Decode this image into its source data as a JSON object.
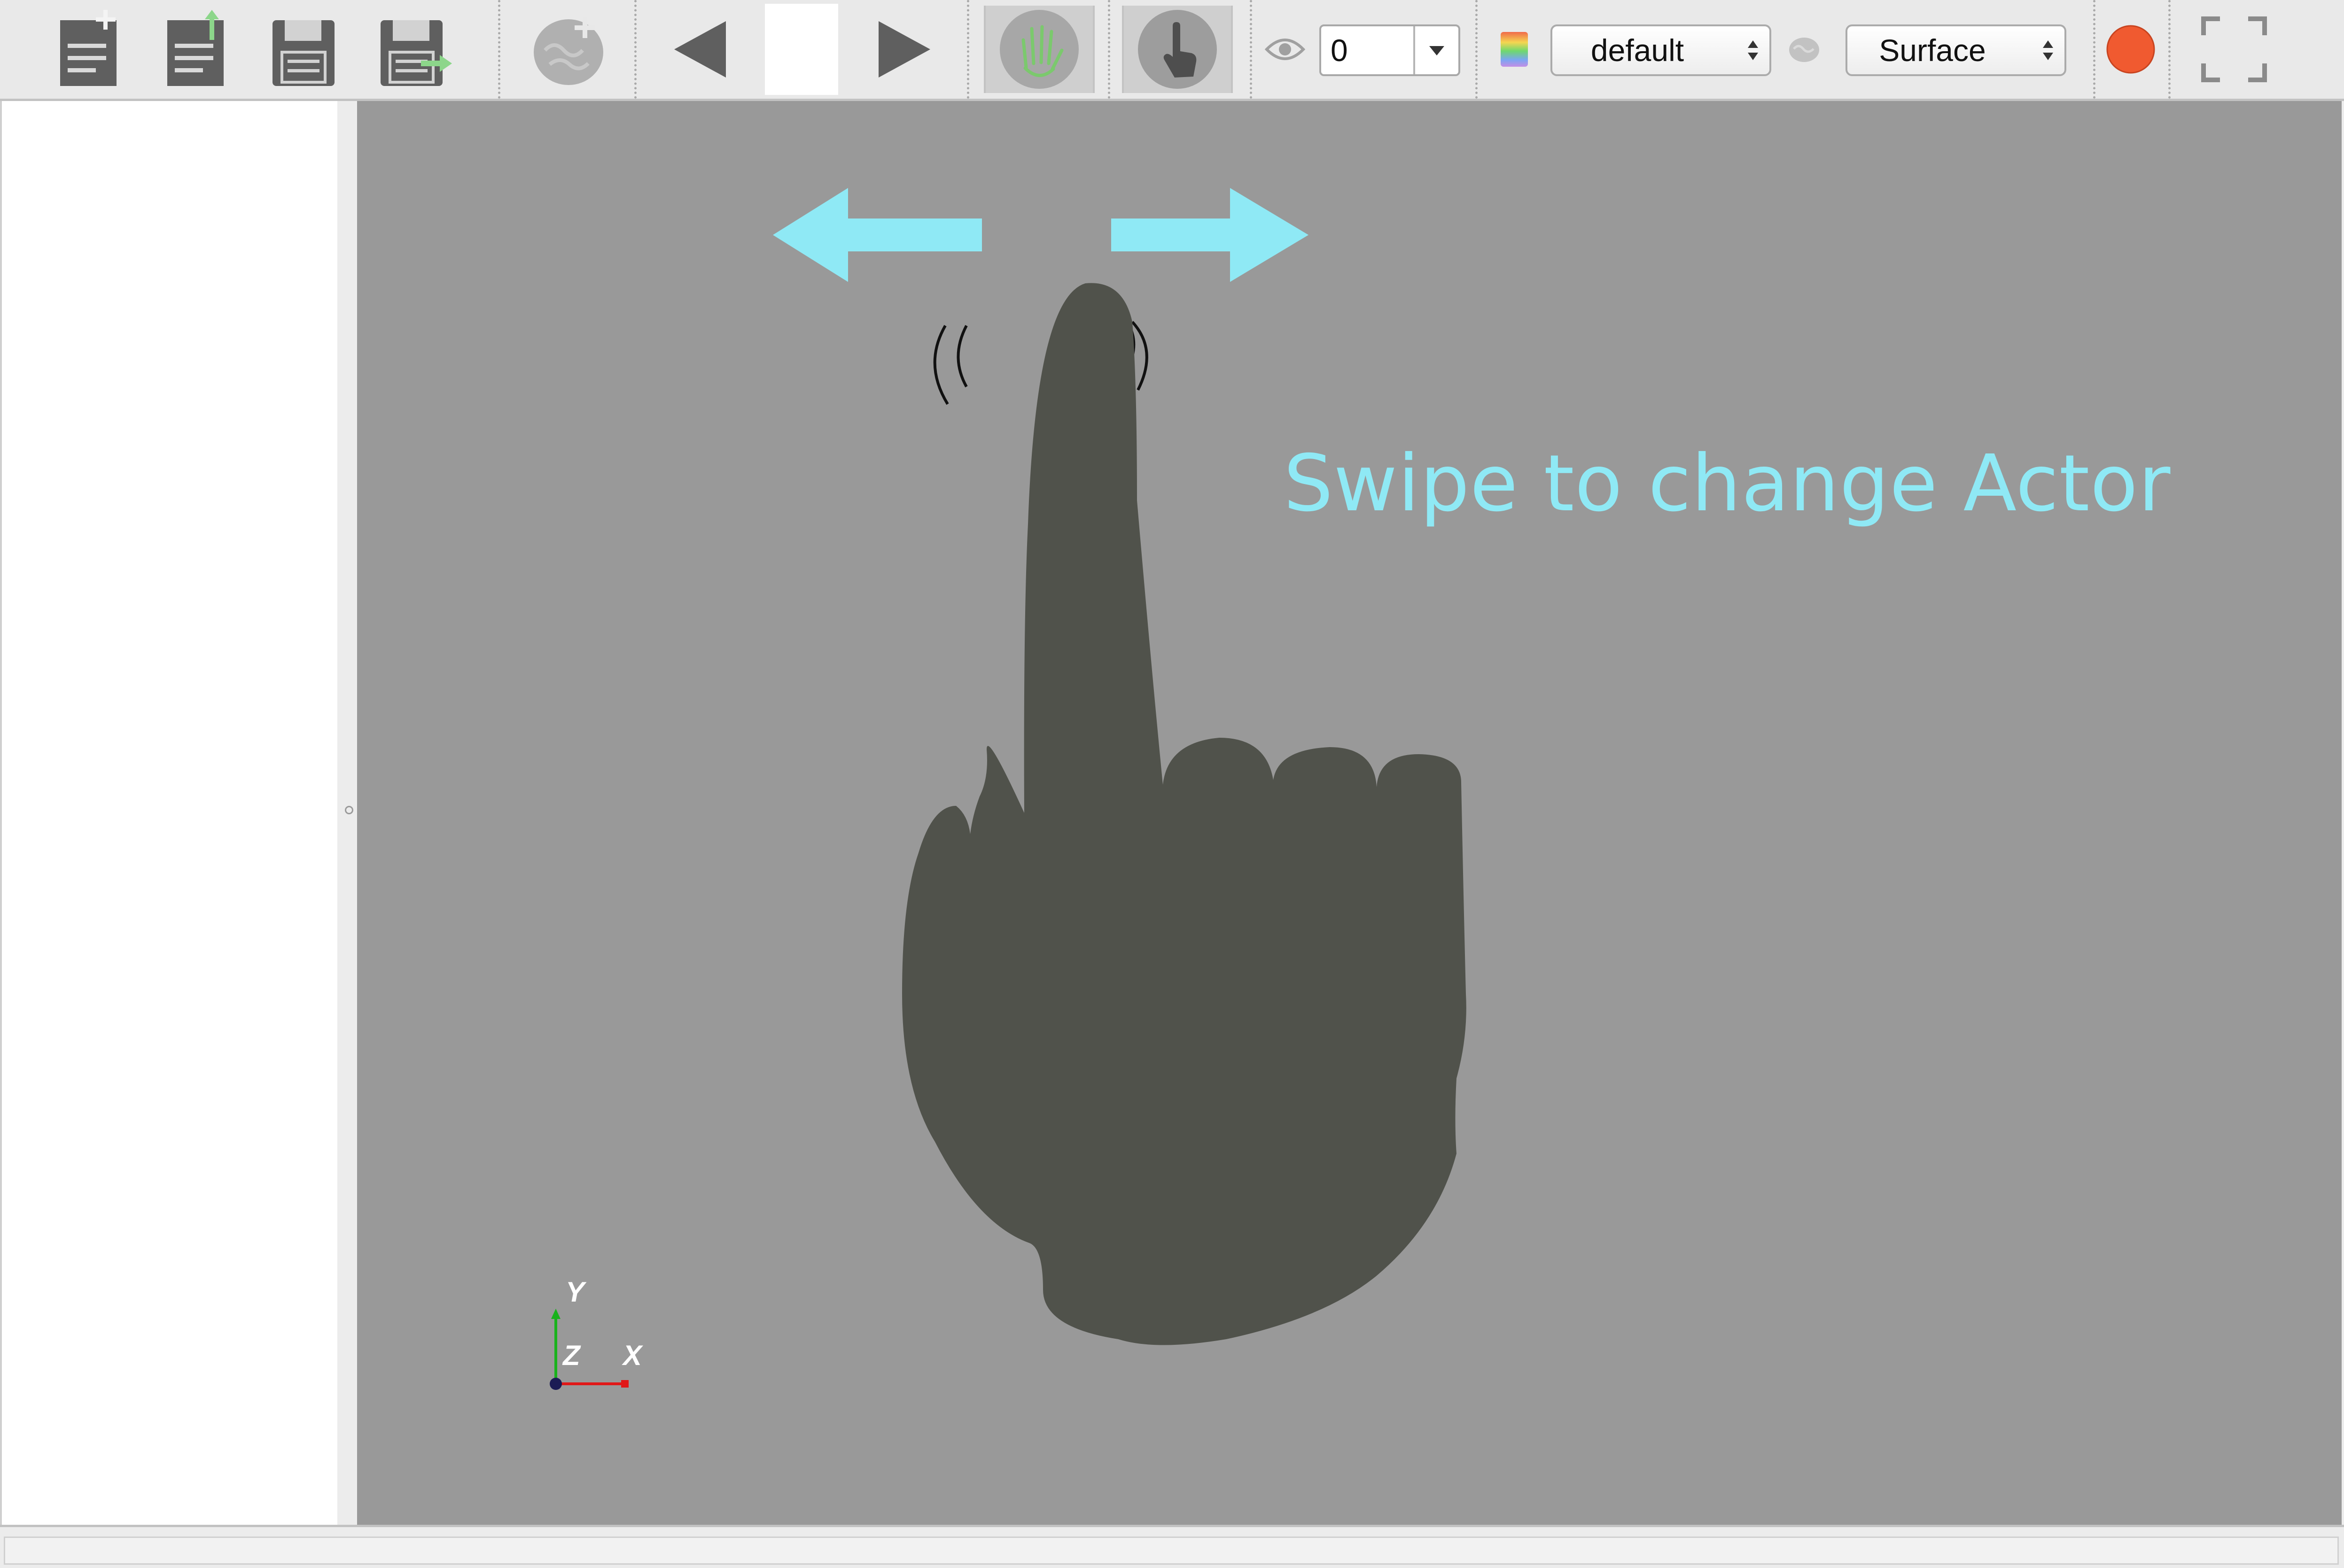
{
  "toolbar": {
    "buttons": [
      {
        "name": "new-file-icon",
        "tooltip": "New"
      },
      {
        "name": "load-file-icon",
        "tooltip": "Open"
      },
      {
        "name": "save-icon",
        "tooltip": "Save"
      },
      {
        "name": "save-as-icon",
        "tooltip": "Save As"
      },
      {
        "name": "add-brain-icon",
        "tooltip": "Add Brain"
      },
      {
        "name": "previous-icon",
        "tooltip": "Previous"
      },
      {
        "name": "next-icon",
        "tooltip": "Next"
      },
      {
        "name": "hand-tracking-icon",
        "tooltip": "Hand tracking"
      },
      {
        "name": "touch-icon",
        "tooltip": "Touch"
      }
    ],
    "visibility_value": "0",
    "colormap_selected": "default",
    "render_mode_selected": "Surface",
    "record_color": "#f05a30"
  },
  "viewport": {
    "instruction_text": "Swipe to change Actor",
    "instruction_color": "#8fe9f5",
    "background_color": "#999999",
    "hand_color": "#50524b",
    "arrow_color": "#8fe9f5",
    "axes": {
      "x_label": "X",
      "y_label": "Y",
      "z_label": "Z"
    }
  },
  "colors": {
    "toolbar_bg": "#e9e9e9",
    "icon_gray": "#5f5f5f",
    "accent_green": "#8cd68a"
  }
}
